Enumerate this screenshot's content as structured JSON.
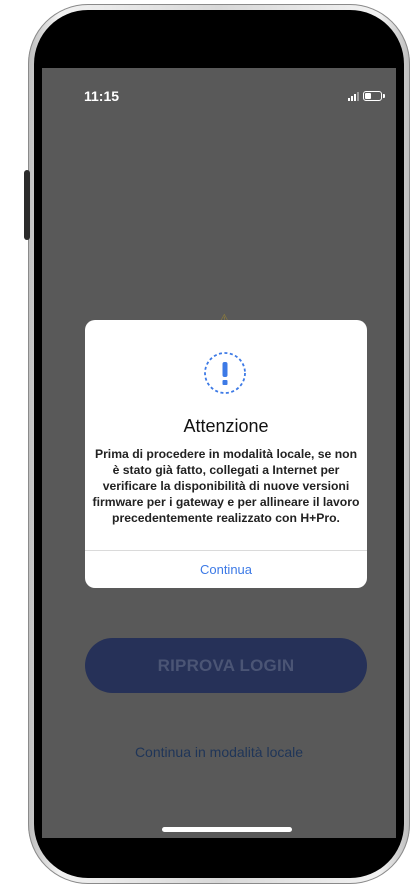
{
  "status_bar": {
    "time": "11:15",
    "signal_icon": "signal-bars-icon",
    "battery_icon": "battery-icon",
    "battery_level": 0.35
  },
  "background": {
    "warning_icon": "warning-icon",
    "retry_button_label": "RIPROVA LOGIN",
    "local_mode_link": "Continua in modalità locale"
  },
  "dialog": {
    "icon": "exclamation-circle-icon",
    "title": "Attenzione",
    "message": "Prima di procedere in modalità locale, se non è stato già fatto, collegati a Internet per verificare la disponibilità di nuove versioni firmware per i gateway e per allineare il lavoro precedentemente realizzato con H+Pro.",
    "button_label": "Continua"
  },
  "colors": {
    "overlay": "#595959",
    "accent": "#3d7ae6",
    "retry_button": "#263158"
  }
}
